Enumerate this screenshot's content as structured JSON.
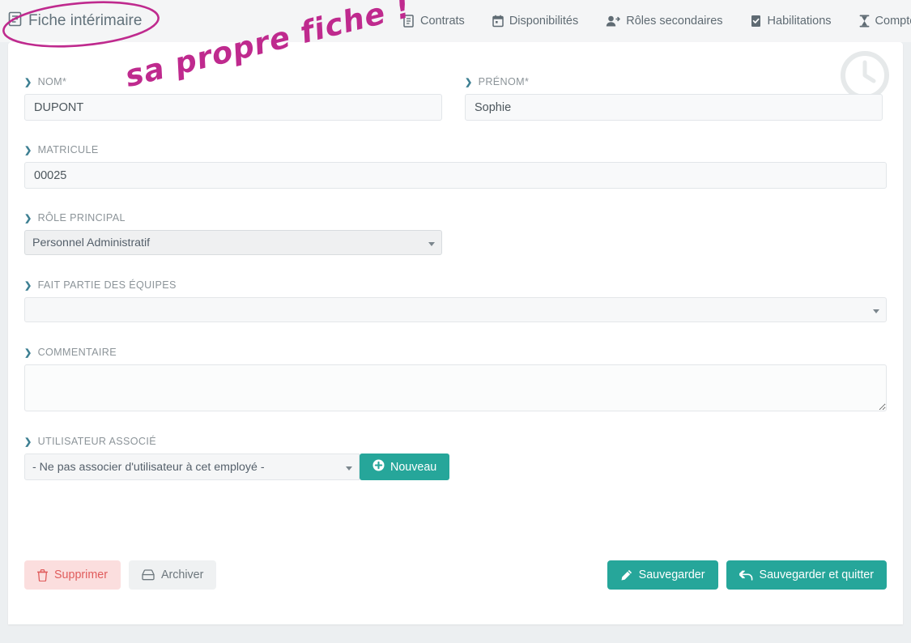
{
  "header": {
    "title": "Fiche intérimaire",
    "title_icon": "document-icon",
    "nav": [
      {
        "label": "Contrats",
        "icon": "document-icon"
      },
      {
        "label": "Disponibilités",
        "icon": "calendar-icon"
      },
      {
        "label": "Rôles secondaires",
        "icon": "user-add-icon"
      },
      {
        "label": "Habilitations",
        "icon": "badge-check-icon"
      },
      {
        "label": "Compteurs d'absence",
        "icon": "hourglass-icon"
      }
    ]
  },
  "watermark": {
    "icon": "clock-circle-icon"
  },
  "form": {
    "nom": {
      "label": "NOM*",
      "value": "DUPONT",
      "placeholder": ""
    },
    "prenom": {
      "label": "PRÉNOM*",
      "value": "Sophie",
      "placeholder": ""
    },
    "matricule": {
      "label": "MATRICULE",
      "value": "00025",
      "placeholder": ""
    },
    "role_principal": {
      "label": "RÔLE PRINCIPAL",
      "value": "Personnel Administratif",
      "options": [
        "Personnel Administratif"
      ]
    },
    "equipes": {
      "label": "FAIT PARTIE DES ÉQUIPES",
      "value": "",
      "options": []
    },
    "commentaire": {
      "label": "COMMENTAIRE",
      "value": "",
      "placeholder": ""
    },
    "utilisateur_associe": {
      "label": "UTILISATEUR ASSOCIÉ",
      "value": "- Ne pas associer d'utilisateur à cet employé -",
      "options": [
        "- Ne pas associer d'utilisateur à cet employé -"
      ],
      "new_button": {
        "label": "Nouveau",
        "icon": "plus-circle-icon"
      }
    }
  },
  "actions": {
    "delete": {
      "label": "Supprimer",
      "icon": "trash-icon"
    },
    "archive": {
      "label": "Archiver",
      "icon": "archive-icon"
    },
    "save": {
      "label": "Sauvegarder",
      "icon": "pencil-icon"
    },
    "save_quit": {
      "label": "Sauvegarder et quitter",
      "icon": "reply-icon"
    }
  },
  "annotation": {
    "text": "sa propre fiche !",
    "color": "#bf2a8e",
    "circle": "ellipse-around-title"
  }
}
